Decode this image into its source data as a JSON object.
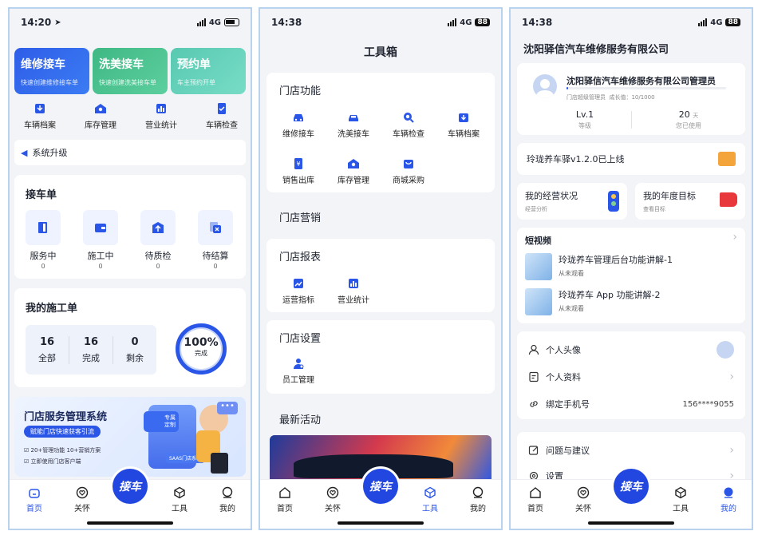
{
  "s1": {
    "status": {
      "time": "14:20",
      "net": "4G"
    },
    "banners": [
      {
        "title": "维修接车",
        "sub": "快速创建维修接车单",
        "color": "#2e5de8"
      },
      {
        "title": "洗美接车",
        "sub": "快速创建洗美接车单",
        "color": "#45c08f"
      },
      {
        "title": "预约单",
        "sub": "车主预约开单",
        "color": "#5fcfb8"
      }
    ],
    "quick": [
      "车辆档案",
      "库存管理",
      "营业统计",
      "车辆检查"
    ],
    "notice": "系统升级",
    "jiecheTitle": "接车单",
    "jieche": [
      {
        "label": "服务中",
        "count": "0"
      },
      {
        "label": "施工中",
        "count": "0"
      },
      {
        "label": "待质检",
        "count": "0"
      },
      {
        "label": "待结算",
        "count": "0"
      }
    ],
    "workTitle": "我的施工单",
    "work": [
      {
        "num": "16",
        "label": "全部"
      },
      {
        "num": "16",
        "label": "完成"
      },
      {
        "num": "0",
        "label": "剩余"
      }
    ],
    "ring": {
      "pct": "100%",
      "label": "完成",
      "value": 1.0
    },
    "promo": {
      "title": "门店服务管理系统",
      "pill": "赋能门店快速获客引流",
      "b1": "20+管理功能 10+营销方案",
      "b2": "立即使用门店客户端",
      "tag1": "专属",
      "tag2": "定制",
      "tag3": "SAAS门店系统"
    }
  },
  "s2": {
    "status": {
      "time": "14:38",
      "net": "4G",
      "bat": "88"
    },
    "title": "工具箱",
    "storeFunc": {
      "title": "门店功能",
      "items": [
        "维修接车",
        "洗美接车",
        "车辆检查",
        "车辆档案",
        "销售出库",
        "库存管理",
        "商城采购"
      ]
    },
    "marketing": "门店营销",
    "reports": {
      "title": "门店报表",
      "items": [
        "运营指标",
        "营业统计"
      ]
    },
    "settings": {
      "title": "门店设置",
      "items": [
        "员工管理"
      ]
    },
    "activities": "最新活动"
  },
  "s3": {
    "status": {
      "time": "14:38",
      "net": "4G",
      "bat": "88"
    },
    "company": "沈阳驿信汽车维修服务有限公司",
    "user": {
      "name": "沈阳驿信汽车维修服务有限公司管理员",
      "role": "门店超级管理员",
      "growth": "成长值：10/1000",
      "level": "Lv.1",
      "levelLabel": "等级",
      "days": "20",
      "daysUnit": "天",
      "daysLabel": "您已使用"
    },
    "update": "玲珑养车驿v1.2.0已上线",
    "ops": {
      "title": "我的经营状况",
      "sub": "经营分析"
    },
    "goal": {
      "title": "我的年度目标",
      "sub": "查看目标"
    },
    "videos": {
      "title": "短视频",
      "items": [
        {
          "title": "玲珑养车管理后台功能讲解-1",
          "status": "从未观看"
        },
        {
          "title": "玲珑养车 App 功能讲解-2",
          "status": "从未观看"
        }
      ]
    },
    "settingsList": [
      {
        "label": "个人头像",
        "value": ""
      },
      {
        "label": "个人资料",
        "value": ""
      },
      {
        "label": "绑定手机号",
        "value": "156****9055"
      }
    ],
    "more": [
      "问题与建议",
      "设置"
    ]
  },
  "tabs": {
    "home": "首页",
    "care": "关怀",
    "fab": "接车",
    "tools": "工具",
    "mine": "我的"
  },
  "colors": {
    "accent": "#2a56e8",
    "blue": "#2147e0",
    "green": "#45c08f",
    "teal": "#5fcfb8"
  }
}
